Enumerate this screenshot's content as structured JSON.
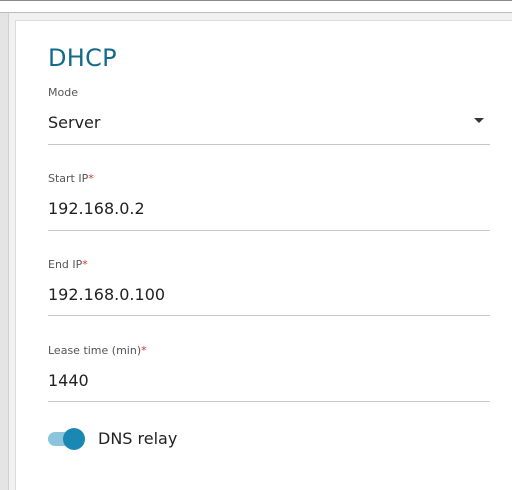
{
  "section": {
    "title": "DHCP"
  },
  "fields": {
    "mode": {
      "label": "Mode",
      "value": "Server"
    },
    "start_ip": {
      "label": "Start IP",
      "required_mark": "*",
      "value": "192.168.0.2"
    },
    "end_ip": {
      "label": "End IP",
      "required_mark": "*",
      "value": "192.168.0.100"
    },
    "lease_time": {
      "label": "Lease time (min)",
      "required_mark": "*",
      "value": "1440"
    }
  },
  "dns_relay": {
    "label": "DNS relay",
    "enabled": true
  },
  "colors": {
    "title": "#136a8a",
    "required": "#d0342c",
    "toggle_on_knob": "#1b87b3",
    "toggle_on_track": "#8cc4dc"
  },
  "icons": {
    "mode_dropdown": "caret-down-icon"
  }
}
